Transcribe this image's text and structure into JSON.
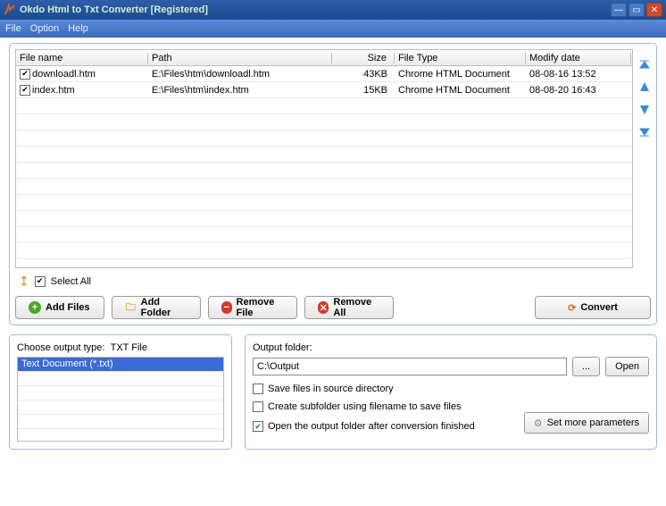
{
  "titlebar": {
    "title": "Okdo Html to Txt Converter [Registered]"
  },
  "menu": {
    "file": "File",
    "option": "Option",
    "help": "Help"
  },
  "columns": {
    "name": "File name",
    "path": "Path",
    "size": "Size",
    "type": "File Type",
    "date": "Modify date"
  },
  "files": [
    {
      "checked": true,
      "name": "downloadl.htm",
      "path": "E:\\Files\\htm\\downloadl.htm",
      "size": "43KB",
      "type": "Chrome HTML Document",
      "date": "08-08-16 13:52"
    },
    {
      "checked": true,
      "name": "index.htm",
      "path": "E:\\Files\\htm\\index.htm",
      "size": "15KB",
      "type": "Chrome HTML Document",
      "date": "08-08-20 16:43"
    }
  ],
  "selectAll": {
    "label": "Select All",
    "checked": true
  },
  "buttons": {
    "addFiles": "Add Files",
    "addFolder": "Add Folder",
    "removeFile": "Remove File",
    "removeAll": "Remove All",
    "convert": "Convert",
    "browse": "...",
    "open": "Open",
    "setMore": "Set more parameters"
  },
  "output": {
    "chooseTypeLabel": "Choose output type:",
    "typeValue": "TXT File",
    "typeOption": "Text Document (*.txt)",
    "folderLabel": "Output folder:",
    "folderPath": "C:\\Output",
    "saveSource": {
      "label": "Save files in source directory",
      "checked": false
    },
    "createSub": {
      "label": "Create subfolder using filename to save files",
      "checked": false
    },
    "openAfter": {
      "label": "Open the output folder after conversion finished",
      "checked": true
    }
  }
}
